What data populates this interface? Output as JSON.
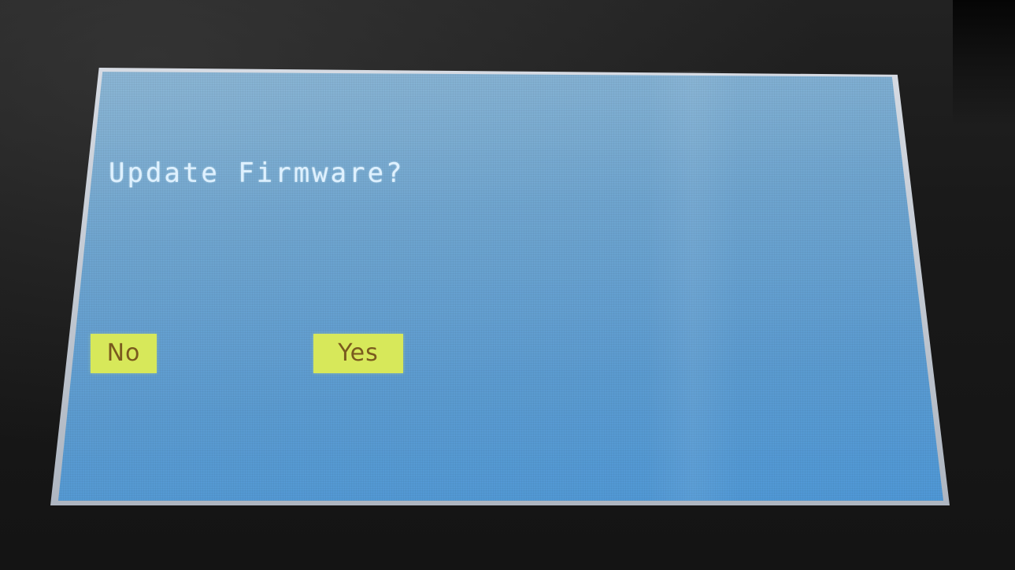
{
  "dialog": {
    "title": "Update Firmware?"
  },
  "options": {
    "no_label": "No",
    "yes_label": "Yes"
  },
  "colors": {
    "screen_background": "#5b9bd0",
    "title_text": "#dff1ff",
    "option_background": "#d7e85a",
    "option_text": "#7a5a1e",
    "device_bezel": "#161616"
  }
}
